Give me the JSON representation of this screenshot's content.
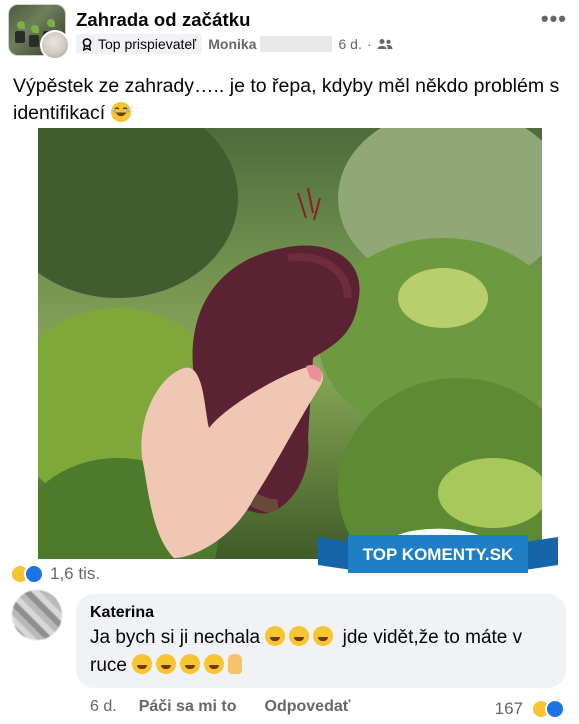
{
  "post": {
    "group_name": "Zahrada od začátku",
    "badge_label": "Top prispievateľ",
    "author": "Monika",
    "time": "6 d.",
    "audience_icon": "members-icon",
    "more_label": "•••",
    "text_main": "Výpěstek ze zahrady….. je to řepa, kdyby měl někdo problém s identifikací"
  },
  "reactions": {
    "count": "1,6 tis.",
    "types": [
      "haha",
      "like"
    ]
  },
  "watermark": {
    "text": "TOP KOMENTY.SK",
    "color": "#1e7fc6"
  },
  "comment": {
    "author": "Katerina",
    "text_part1": "Ja bych si ji nechala",
    "text_part2": "jde vidět,že to máte v ruce",
    "time": "6 d.",
    "like_label": "Páči sa mi to",
    "reply_label": "Odpovedať",
    "reaction_count": "167"
  },
  "colors": {
    "accent": "#1b74e4",
    "secondary_text": "#65676b",
    "bubble": "#f0f2f5",
    "haha": "#f7c531"
  }
}
